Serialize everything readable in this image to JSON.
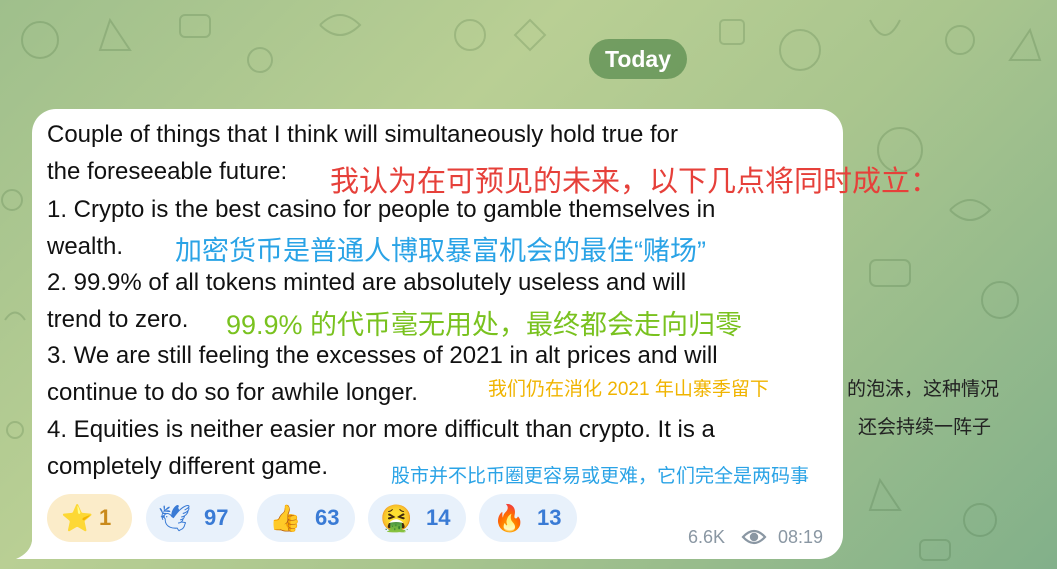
{
  "chat": {
    "date_label": "Today",
    "background_color": "#a9c58e",
    "bubble_color": "#ffffff"
  },
  "message": {
    "lines": [
      "Couple of things that I think will simultaneously hold true for",
      "the foreseeable future:",
      "1. Crypto is the best casino for people to gamble themselves in",
      "wealth.",
      "2. 99.9% of all tokens minted are absolutely useless and will",
      "trend to zero.",
      "3. We are still feeling the excesses of 2021 in alt prices and will",
      "continue to do so for awhile longer.",
      "4. Equities is neither easier nor more difficult than crypto. It is a",
      "completely different game."
    ]
  },
  "annotations": {
    "red": "我认为在可预见的未来，以下几点将同时成立：",
    "blue1": "加密货币是普通人博取暴富机会的最佳“赌场”",
    "green": "99.9% 的代币毫无用处，最终都会走向归零",
    "orange": "我们仍在消化 2021 年山寨季留下",
    "dark1": "的泡沫，这种情况",
    "dark2": "还会持续一阵子",
    "blue2": "股市并不比币圈更容易或更难，它们完全是两码事",
    "colors": {
      "red": "#e6403a",
      "blue": "#2aa3e6",
      "green": "#79c21f",
      "orange": "#f0b400",
      "dark": "#222222"
    }
  },
  "reactions": [
    {
      "icon": "star-icon",
      "emoji": "⭐",
      "count": "1",
      "color": "#c98a1b"
    },
    {
      "icon": "dove-icon",
      "emoji": "🕊",
      "count": "97",
      "color": "#3a7bd5"
    },
    {
      "icon": "thumbs-up-icon",
      "emoji": "👍",
      "count": "63",
      "color": "#3a7bd5"
    },
    {
      "icon": "nauseated-face-icon",
      "emoji": "🤮",
      "count": "14",
      "color": "#3a7bd5"
    },
    {
      "icon": "fire-icon",
      "emoji": "🔥",
      "count": "13",
      "color": "#3a7bd5"
    }
  ],
  "meta": {
    "views": "6.6K",
    "views_icon": "eye-icon",
    "time": "08:19"
  }
}
